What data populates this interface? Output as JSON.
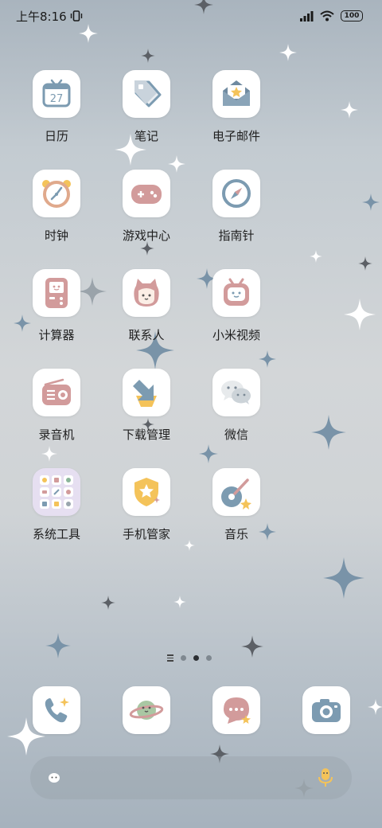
{
  "status_bar": {
    "time": "上午8:16",
    "battery": "100"
  },
  "apps": [
    {
      "label": "日历",
      "icon": "calendar-icon",
      "date_number": "27"
    },
    {
      "label": "笔记",
      "icon": "notes-tag-icon"
    },
    {
      "label": "电子邮件",
      "icon": "envelope-icon"
    },
    {
      "label": "时钟",
      "icon": "alarm-clock-icon"
    },
    {
      "label": "游戏中心",
      "icon": "gamepad-icon"
    },
    {
      "label": "指南针",
      "icon": "compass-icon"
    },
    {
      "label": "计算器",
      "icon": "calculator-icon"
    },
    {
      "label": "联系人",
      "icon": "contacts-character-icon"
    },
    {
      "label": "小米视频",
      "icon": "tv-face-icon"
    },
    {
      "label": "录音机",
      "icon": "radio-recorder-icon"
    },
    {
      "label": "下载管理",
      "icon": "download-arrow-icon"
    },
    {
      "label": "微信",
      "icon": "wechat-bubbles-icon"
    },
    {
      "label": "系统工具",
      "icon": "folder-grid-icon"
    },
    {
      "label": "手机管家",
      "icon": "shield-star-icon"
    },
    {
      "label": "音乐",
      "icon": "guitar-icon"
    }
  ],
  "page_indicator": {
    "pages": 3,
    "current": 2
  },
  "dock": [
    {
      "icon": "phone-icon"
    },
    {
      "icon": "planet-browser-icon"
    },
    {
      "icon": "messages-bubble-icon"
    },
    {
      "icon": "camera-icon"
    }
  ],
  "colors": {
    "icon_bg": "#ffffff",
    "accent_blue": "#7c9bb1",
    "accent_pink": "#d29b9b",
    "accent_yellow": "#f4c35a",
    "folder_bg": "#e6dff1"
  }
}
